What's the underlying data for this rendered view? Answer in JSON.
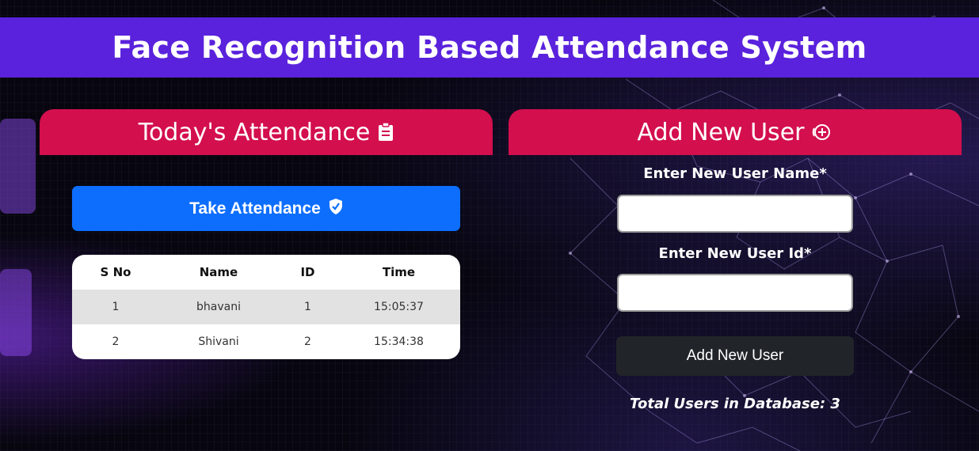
{
  "header": {
    "title": "Face Recognition Based Attendance System"
  },
  "attendance_panel": {
    "title": "Today's Attendance",
    "title_icon": "clipboard-icon",
    "take_button_label": "Take Attendance",
    "take_button_icon": "shield-check-icon",
    "table": {
      "columns": [
        "S No",
        "Name",
        "ID",
        "Time"
      ],
      "rows": [
        {
          "sno": "1",
          "name": "bhavani",
          "id": "1",
          "time": "15:05:37"
        },
        {
          "sno": "2",
          "name": "Shivani",
          "id": "2",
          "time": "15:34:38"
        }
      ]
    }
  },
  "add_user_panel": {
    "title": "Add New User",
    "title_icon": "plus-circle-icon",
    "name_label": "Enter New User Name*",
    "name_value": "",
    "id_label": "Enter New User Id*",
    "id_value": "",
    "submit_label": "Add New User",
    "total_text": "Total Users in Database: 3"
  },
  "colors": {
    "header_bg": "#5a22dc",
    "panel_header_bg": "#d30f4e",
    "primary_button": "#0d6efd",
    "dark_button": "#212529"
  }
}
